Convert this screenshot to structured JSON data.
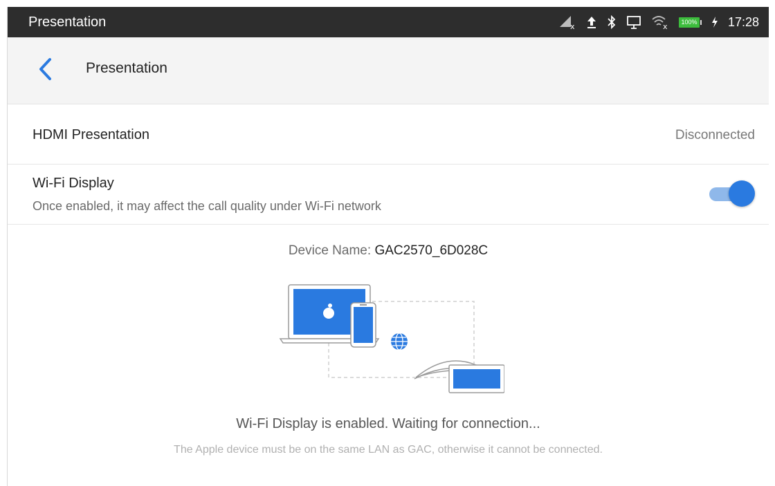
{
  "statusbar": {
    "app_title": "Presentation",
    "time": "17:28",
    "battery_percent": "100%",
    "icons": [
      "network-off-icon",
      "upload-icon",
      "bluetooth-icon",
      "screen-cast-icon",
      "wifi-off-icon",
      "battery-icon",
      "charging-icon"
    ]
  },
  "toolbar": {
    "title": "Presentation",
    "back_icon": "chevron-left-icon",
    "accent": "#2a7ae0"
  },
  "hdmi": {
    "label": "HDMI Presentation",
    "status": "Disconnected"
  },
  "wifi_display": {
    "label": "Wi-Fi Display",
    "description": "Once enabled, it may affect the call quality under Wi-Fi network",
    "enabled": true
  },
  "device": {
    "label": "Device Name: ",
    "name": "GAC2570_6D028C"
  },
  "connection": {
    "status": "Wi-Fi Display is enabled. Waiting for connection...",
    "note": "The Apple device must be on the same LAN as GAC, otherwise it cannot be connected."
  }
}
